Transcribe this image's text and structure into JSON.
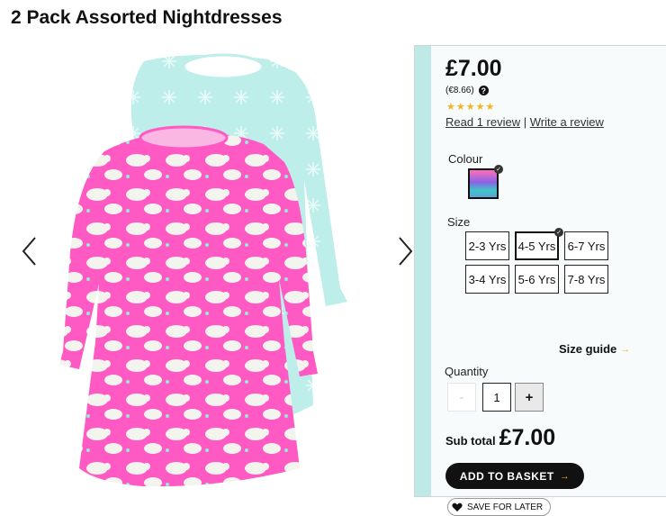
{
  "product": {
    "title": "2 Pack Assorted Nightdresses"
  },
  "price": {
    "main": "£7.00",
    "euro": "(€8.66)",
    "help_icon": "?"
  },
  "rating": {
    "stars": "★★★★★",
    "value": 5,
    "read_reviews": "Read 1 review",
    "separator": "|",
    "write_review": "Write a review"
  },
  "colour": {
    "label": "Colour"
  },
  "size": {
    "label": "Size",
    "options": [
      "2-3 Yrs",
      "4-5 Yrs",
      "6-7 Yrs",
      "3-4 Yrs",
      "5-6 Yrs",
      "7-8 Yrs"
    ],
    "selected": "4-5 Yrs"
  },
  "size_guide": {
    "label": "Size guide",
    "arrow": "→"
  },
  "quantity": {
    "label": "Quantity",
    "minus": "-",
    "value": "1",
    "plus": "+"
  },
  "subtotal": {
    "label": "Sub total",
    "value": "£7.00"
  },
  "actions": {
    "add_to_basket": "ADD TO BASKET",
    "add_arrow": "→",
    "save_for_later": "SAVE FOR LATER"
  },
  "colors": {
    "star": "#f3b51d",
    "pink_dress": "#ff59c4",
    "mint_dress": "#bdeee9",
    "button_dark": "#111111"
  }
}
